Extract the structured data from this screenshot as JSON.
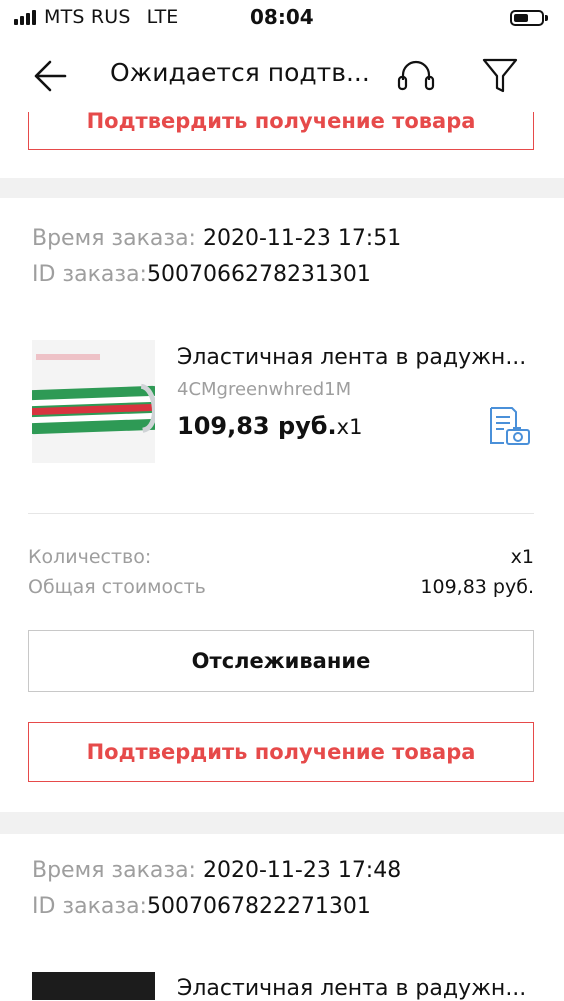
{
  "status_bar": {
    "carrier": "MTS RUS",
    "network": "LTE",
    "time": "08:04"
  },
  "nav": {
    "title": "Ожидается подтв...",
    "back_icon": "arrow-left-icon",
    "support_icon": "headset-icon",
    "filter_icon": "filter-icon"
  },
  "top_partial": {
    "confirm_label": "Подтвердить получение товара"
  },
  "orders": [
    {
      "time_label": "Время заказа:",
      "time_value": "2020-11-23 17:51",
      "id_label": "ID заказа:",
      "id_value": "5007066278231301",
      "product_title": "Эластичная лента в радужн...",
      "product_sku": "4CMgreenwhred1M",
      "product_price": "109,83 руб.",
      "product_qty": "x1",
      "snapshot_icon": "document-camera-icon",
      "quantity_label": "Количество:",
      "quantity_value": "x1",
      "total_label": "Общая стоимость",
      "total_value": "109,83 руб.",
      "track_label": "Отслеживание",
      "confirm_label": "Подтвердить получение товара"
    },
    {
      "time_label": "Время заказа:",
      "time_value": "2020-11-23 17:48",
      "id_label": "ID заказа:",
      "id_value": "5007067822271301",
      "product_title": "Эластичная лента в радужн..."
    }
  ],
  "colors": {
    "accent_red": "#e64a4a",
    "icon_blue": "#4a90d9",
    "separator": "#f1f1f1"
  }
}
